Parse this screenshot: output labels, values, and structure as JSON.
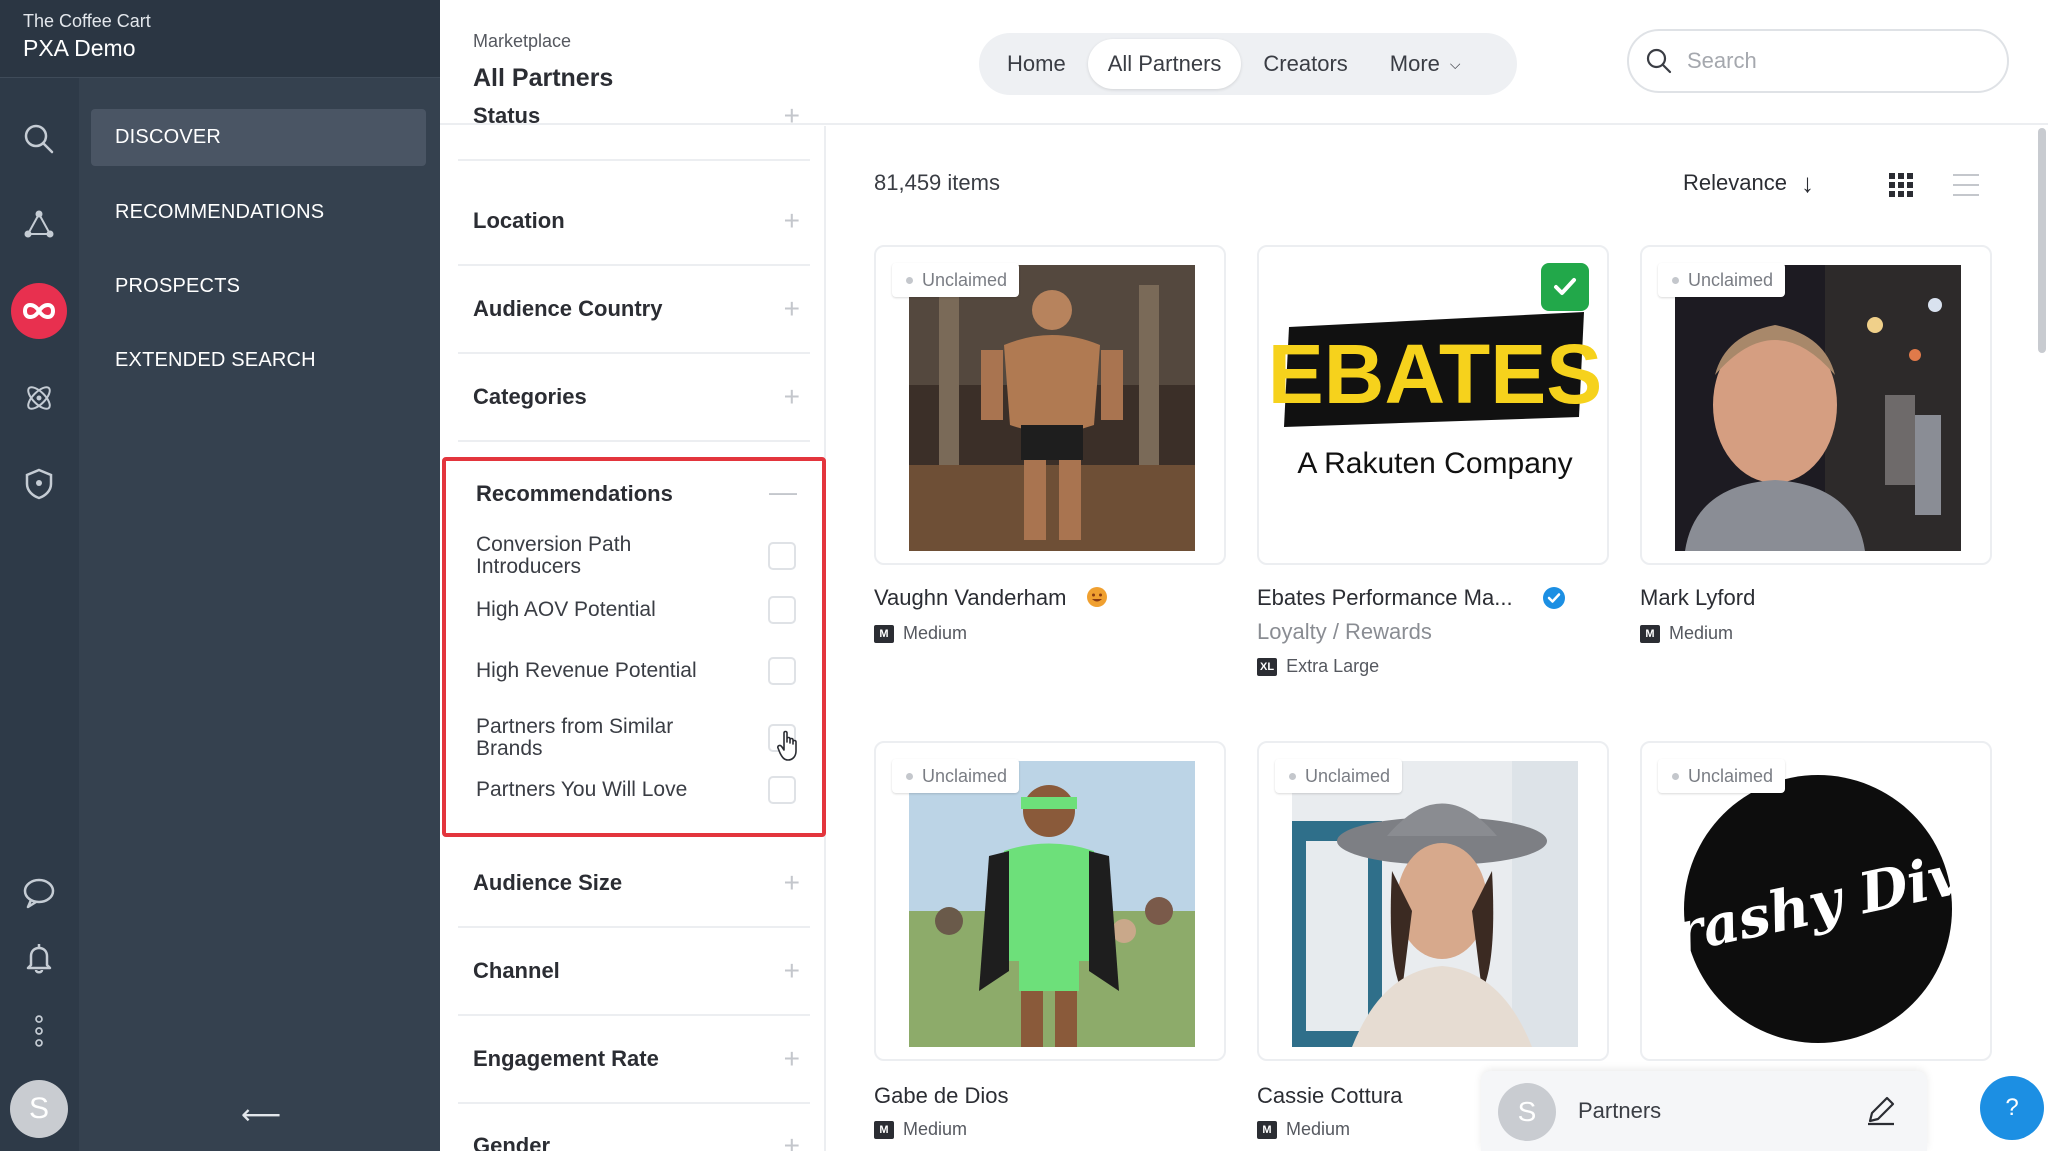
{
  "brand": {
    "company": "The Coffee Cart",
    "workspace": "PXA Demo"
  },
  "nav": {
    "items": [
      {
        "label": "DISCOVER",
        "active": true
      },
      {
        "label": "RECOMMENDATIONS"
      },
      {
        "label": "PROSPECTS"
      },
      {
        "label": "EXTENDED SEARCH"
      }
    ],
    "collapse_glyph": "⟵"
  },
  "rail": {
    "icons": [
      "search-icon",
      "network-icon",
      "infinity-icon",
      "atom-icon",
      "shield-icon",
      "chat-icon",
      "bell-icon",
      "more-vertical-icon"
    ],
    "avatar_initial": "S",
    "accent": "#e8304f"
  },
  "header": {
    "breadcrumb": "Marketplace",
    "title": "All Partners",
    "tabs": [
      {
        "label": "Home"
      },
      {
        "label": "All Partners",
        "active": true
      },
      {
        "label": "Creators"
      },
      {
        "label": "More"
      }
    ],
    "search_placeholder": "Search"
  },
  "filters": {
    "before": [
      "Status",
      "Location",
      "Audience Country",
      "Categories"
    ],
    "recommendations": {
      "title": "Recommendations",
      "options": [
        "Conversion Path Introducers",
        "High AOV Potential",
        "High Revenue Potential",
        "Partners from Similar Brands",
        "Partners You Will Love"
      ]
    },
    "after": [
      "Audience Size",
      "Channel",
      "Engagement Rate",
      "Gender"
    ]
  },
  "results": {
    "count_text": "81,459 items",
    "sort_label": "Relevance",
    "cards": [
      {
        "name": "Vaughn Vanderham",
        "size_badge": "M",
        "size": "Medium",
        "badge": "Unclaimed"
      },
      {
        "name": "Ebates Performance Ma...",
        "subcategory": "Loyalty / Rewards",
        "size_badge": "XL",
        "size": "Extra Large",
        "verified": true,
        "logo_text": "EBATES",
        "logo_tagline": "A Rakuten Company"
      },
      {
        "name": "Mark Lyford",
        "size_badge": "M",
        "size": "Medium",
        "badge": "Unclaimed"
      },
      {
        "name": "Gabe de Dios",
        "size_badge": "M",
        "size": "Medium",
        "badge": "Unclaimed"
      },
      {
        "name": "Cassie Cottura",
        "size_badge": "M",
        "size": "Medium",
        "badge": "Unclaimed"
      },
      {
        "badge": "Unclaimed",
        "logo_text": "Trashy Diva"
      }
    ]
  },
  "partners_pill": {
    "avatar_initial": "S",
    "label": "Partners"
  },
  "help_label": "?"
}
